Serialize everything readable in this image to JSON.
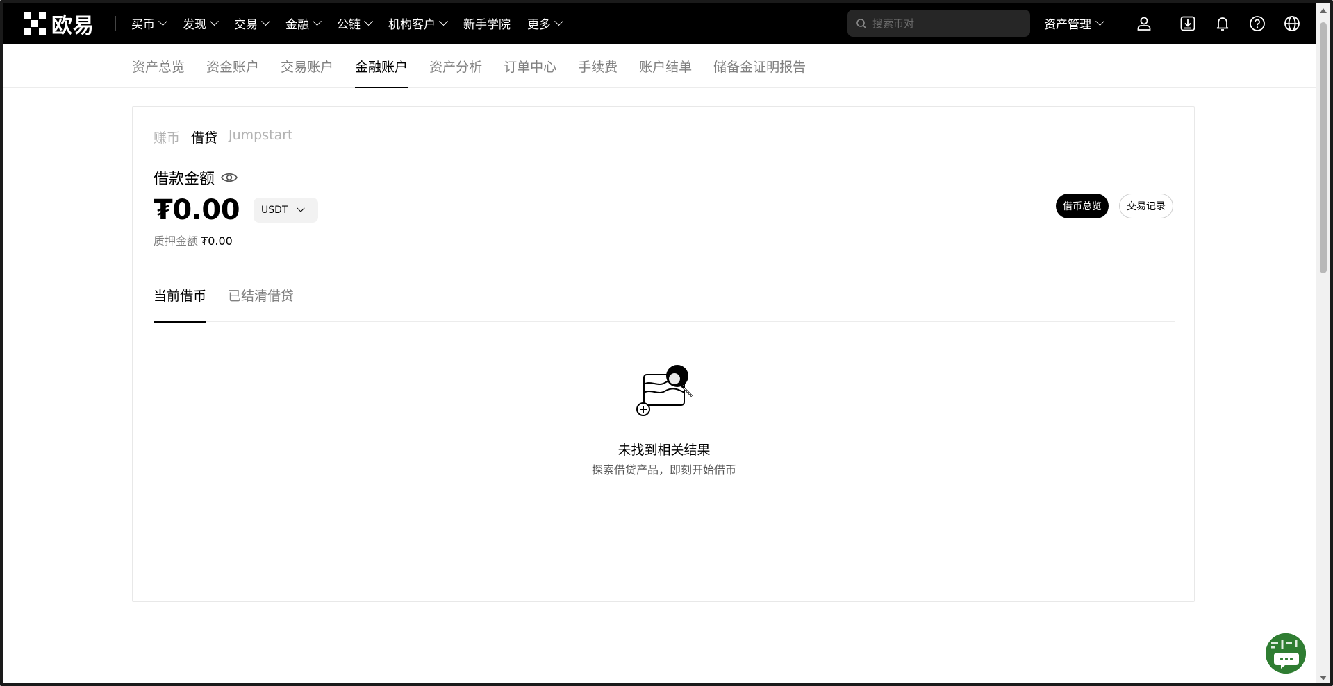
{
  "topnav": {
    "brand": "欧易",
    "items": [
      {
        "label": "买币",
        "dropdown": true
      },
      {
        "label": "发现",
        "dropdown": true
      },
      {
        "label": "交易",
        "dropdown": true
      },
      {
        "label": "金融",
        "dropdown": true
      },
      {
        "label": "公链",
        "dropdown": true
      },
      {
        "label": "机构客户",
        "dropdown": true
      },
      {
        "label": "新手学院",
        "dropdown": false
      },
      {
        "label": "更多",
        "dropdown": true
      }
    ],
    "search_placeholder": "搜索币对",
    "asset_management": "资产管理",
    "icons": [
      "user-icon",
      "download-icon",
      "bell-icon",
      "help-icon",
      "globe-icon"
    ]
  },
  "subnav": {
    "items": [
      "资产总览",
      "资金账户",
      "交易账户",
      "金融账户",
      "资产分析",
      "订单中心",
      "手续费",
      "账户结单",
      "储备金证明报告"
    ],
    "active": "金融账户"
  },
  "card": {
    "type_tabs": [
      "赚币",
      "借贷",
      "Jumpstart"
    ],
    "active_type": "借贷",
    "borrow_label": "借款金额",
    "amount": "₮0.00",
    "currency": "USDT",
    "collateral_label": "质押金额",
    "collateral_value": "₮0.00",
    "btn_overview": "借币总览",
    "btn_records": "交易记录",
    "loan_tabs": [
      "当前借币",
      "已结清借贷"
    ],
    "active_loan_tab": "当前借币",
    "empty_title": "未找到相关结果",
    "empty_subtitle": "探索借贷产品，即刻开始借币"
  },
  "colors": {
    "nav_bg": "#000000",
    "accent": "#000000",
    "muted_text": "#808080",
    "chat_bg": "#2f7d32"
  }
}
